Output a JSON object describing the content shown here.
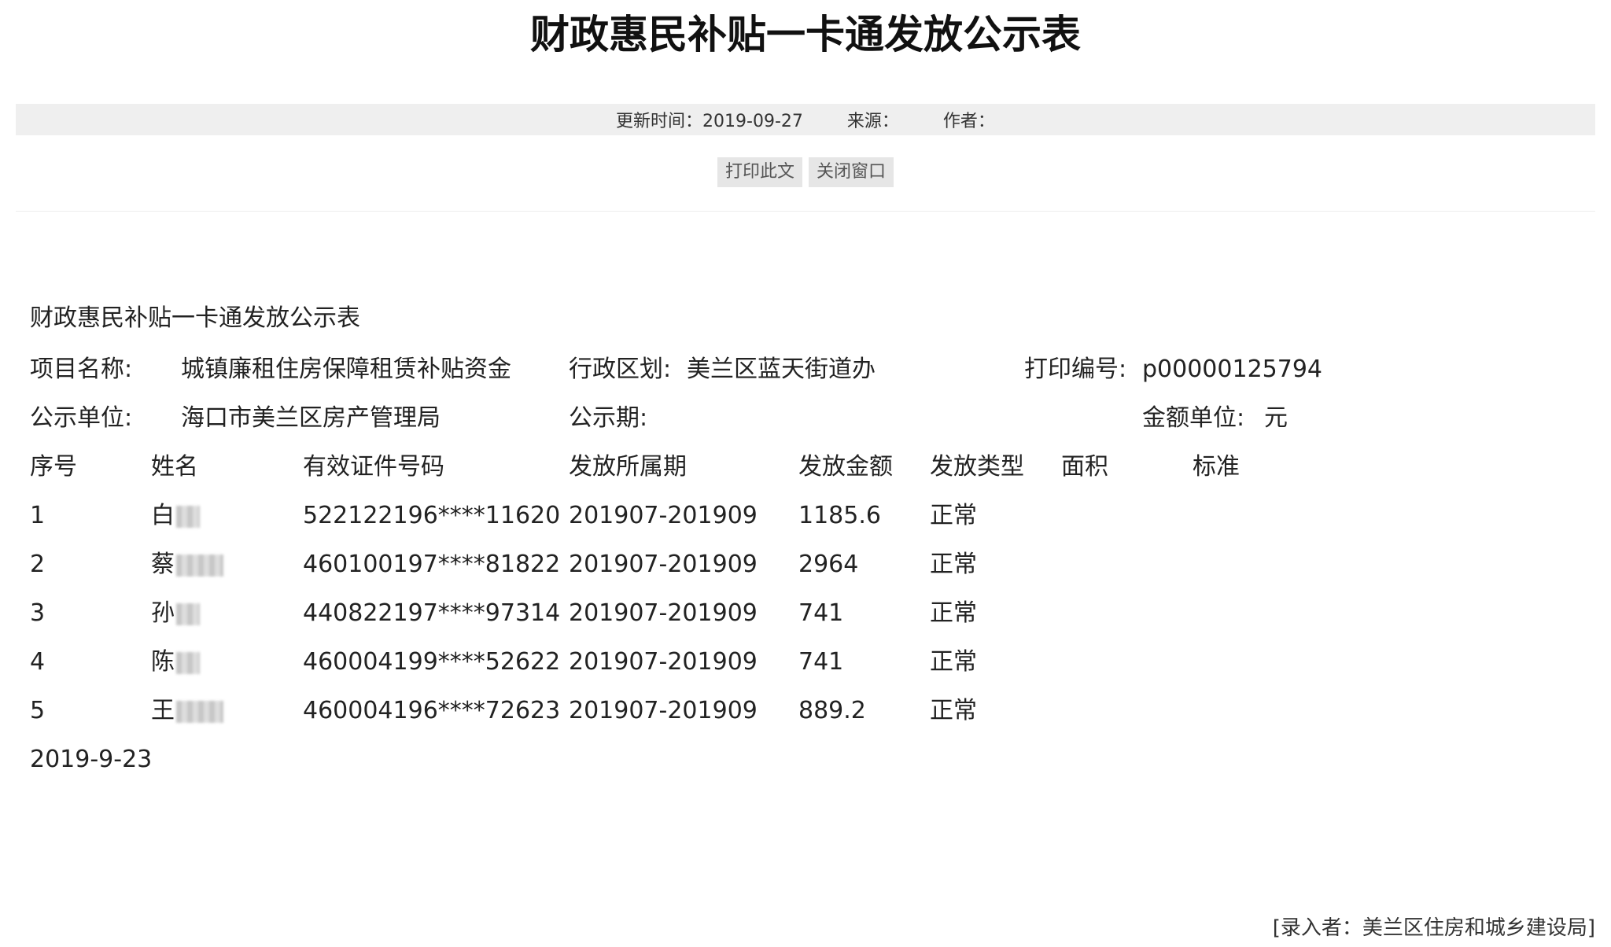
{
  "header": {
    "title": "财政惠民补贴一卡通发放公示表"
  },
  "meta": {
    "updated": "更新时间：2019-09-27",
    "source": "来源：",
    "author": "作者："
  },
  "actions": {
    "print_label": "打印此文",
    "close_label": "关闭窗口"
  },
  "document": {
    "heading": "财政惠民补贴一卡通发放公示表",
    "project_label": "项目名称:",
    "project_value": "城镇廉租住房保障租赁补贴资金",
    "district_label": "行政区划:",
    "district_value": "美兰区蓝天街道办",
    "print_no_label": "打印编号:",
    "print_no_value": "p00000125794",
    "unit_label": "公示单位:",
    "unit_value": "海口市美兰区房产管理局",
    "period_label": "公示期:",
    "currency_label": "金额单位:",
    "currency_value": "元",
    "columns": [
      "序号",
      "姓名",
      "有效证件号码",
      "发放所属期",
      "发放金额",
      "发放类型",
      "面积",
      "标准"
    ],
    "rows": [
      {
        "no": "1",
        "name": "白",
        "id": "522122196****11620",
        "period": "201907-201909",
        "amount": "1185.6",
        "type": "正常"
      },
      {
        "no": "2",
        "name": "蔡",
        "id": "460100197****81822",
        "period": "201907-201909",
        "amount": "2964",
        "type": "正常"
      },
      {
        "no": "3",
        "name": "孙",
        "id": "440822197****97314",
        "period": "201907-201909",
        "amount": "741",
        "type": "正常"
      },
      {
        "no": "4",
        "name": "陈",
        "id": "460004199****52622",
        "period": "201907-201909",
        "amount": "741",
        "type": "正常"
      },
      {
        "no": "5",
        "name": "王",
        "id": "460004196****72623",
        "period": "201907-201909",
        "amount": "889.2",
        "type": "正常"
      }
    ],
    "date": "2019-9-23"
  },
  "footer": {
    "entered_by": "[录入者：美兰区住房和城乡建设局]"
  }
}
